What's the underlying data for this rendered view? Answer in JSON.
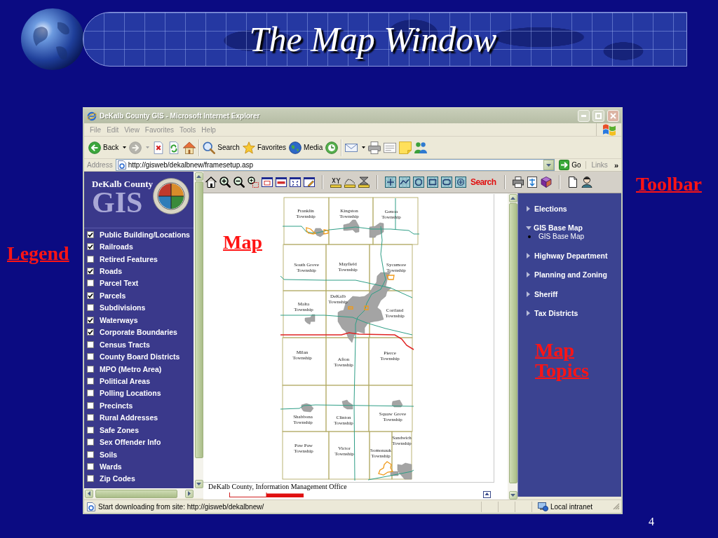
{
  "slide": {
    "title": "The Map Window",
    "page_number": "4"
  },
  "callouts": {
    "toolbar": "Toolbar",
    "map": "Map",
    "legend": "Legend",
    "map_topics": "Map Topics"
  },
  "window": {
    "title": "DeKalb County GIS - Microsoft Internet Explorer",
    "active": false
  },
  "menu": [
    "File",
    "Edit",
    "View",
    "Favorites",
    "Tools",
    "Help"
  ],
  "toolbar": [
    {
      "kind": "back",
      "label": "Back",
      "menu": true,
      "disabled": false
    },
    {
      "kind": "forward",
      "menu": true,
      "disabled": true
    },
    {
      "kind": "stop",
      "menu": false,
      "disabled": false
    },
    {
      "kind": "refresh",
      "menu": false,
      "disabled": false
    },
    {
      "kind": "home",
      "menu": false,
      "disabled": false
    },
    {
      "kind": "separator"
    },
    {
      "kind": "search",
      "label": "Search",
      "menu": false,
      "disabled": false
    },
    {
      "kind": "favorites",
      "label": "Favorites",
      "menu": false,
      "disabled": false
    },
    {
      "kind": "media",
      "label": "Media",
      "menu": false,
      "disabled": false
    },
    {
      "kind": "history",
      "menu": false,
      "disabled": false
    },
    {
      "kind": "separator"
    },
    {
      "kind": "mail",
      "menu": true,
      "disabled": false
    },
    {
      "kind": "print",
      "menu": false,
      "disabled": false
    },
    {
      "kind": "edit",
      "menu": false,
      "disabled": false
    },
    {
      "kind": "discuss",
      "menu": false,
      "disabled": false
    },
    {
      "kind": "messenger",
      "menu": false,
      "disabled": false
    }
  ],
  "address_bar": {
    "label": "Address",
    "value": "http://gisweb/dekalbnew/framesetup.asp",
    "go": "Go",
    "links": "Links",
    "links_more": "»"
  },
  "legend": {
    "county": "DeKalb County",
    "logo": "GIS",
    "layers": [
      {
        "label": "Public Building/Locations",
        "checked": true
      },
      {
        "label": "Railroads",
        "checked": true
      },
      {
        "label": "Retired Features",
        "checked": false
      },
      {
        "label": "Roads",
        "checked": true
      },
      {
        "label": "Parcel Text",
        "checked": false
      },
      {
        "label": "Parcels",
        "checked": true
      },
      {
        "label": "Subdivisions",
        "checked": false
      },
      {
        "label": "Waterways",
        "checked": true
      },
      {
        "label": "Corporate Boundaries",
        "checked": true
      },
      {
        "label": "Census Tracts",
        "checked": false
      },
      {
        "label": "County Board Districts",
        "checked": false
      },
      {
        "label": "MPO (Metro Area)",
        "checked": false
      },
      {
        "label": "Political Areas",
        "checked": false
      },
      {
        "label": "Polling Locations",
        "checked": false
      },
      {
        "label": "Precincts",
        "checked": false
      },
      {
        "label": "Rural Addresses",
        "checked": false
      },
      {
        "label": "Safe Zones",
        "checked": false
      },
      {
        "label": "Sex Offender Info",
        "checked": false
      },
      {
        "label": "Soils",
        "checked": false
      },
      {
        "label": "Wards",
        "checked": false
      },
      {
        "label": "Zip Codes",
        "checked": false
      }
    ]
  },
  "map_toolbar": [
    {
      "kind": "home"
    },
    {
      "kind": "zoom-in"
    },
    {
      "kind": "zoom-out"
    },
    {
      "kind": "zoom-box"
    },
    {
      "kind": "window"
    },
    {
      "kind": "window-bar"
    },
    {
      "kind": "window-arrows"
    },
    {
      "kind": "window-pen"
    },
    {
      "kind": "separator"
    },
    {
      "kind": "xy"
    },
    {
      "kind": "measure"
    },
    {
      "kind": "hourglass"
    },
    {
      "kind": "separator"
    },
    {
      "kind": "grid-cross"
    },
    {
      "kind": "grid-line"
    },
    {
      "kind": "grid-circle"
    },
    {
      "kind": "grid-square"
    },
    {
      "kind": "grid-rounded"
    },
    {
      "kind": "grid-plus"
    },
    {
      "kind": "search",
      "label": "Search"
    },
    {
      "kind": "separator"
    },
    {
      "kind": "print"
    },
    {
      "kind": "export"
    },
    {
      "kind": "book"
    },
    {
      "kind": "separator"
    },
    {
      "kind": "page"
    },
    {
      "kind": "person"
    }
  ],
  "map": {
    "townships": [
      {
        "lines": [
          "Franklin",
          "Township"
        ]
      },
      {
        "lines": [
          "Kingston",
          "Township"
        ]
      },
      {
        "lines": [
          "Genoa",
          "Township"
        ]
      },
      {
        "lines": [
          "South Grove",
          "Township"
        ]
      },
      {
        "lines": [
          "Mayfield",
          "Township"
        ]
      },
      {
        "lines": [
          "Sycamore",
          "Township"
        ]
      },
      {
        "lines": [
          "Malta",
          "Township"
        ]
      },
      {
        "lines": [
          "DeKalb",
          "Township"
        ]
      },
      {
        "lines": [
          "Cortland",
          "Township"
        ]
      },
      {
        "lines": [
          "Milan",
          "Township"
        ]
      },
      {
        "lines": [
          "Afton",
          "Township"
        ]
      },
      {
        "lines": [
          "Pierce",
          "Township"
        ]
      },
      {
        "lines": [
          "Shabbona",
          "Township"
        ]
      },
      {
        "lines": [
          "Clinton",
          "Township"
        ]
      },
      {
        "lines": [
          "Squaw Grove",
          "Township"
        ]
      },
      {
        "lines": [
          "Paw Paw",
          "Township"
        ]
      },
      {
        "lines": [
          "Victor",
          "Township"
        ]
      },
      {
        "lines": [
          "Somonauk",
          "Township"
        ]
      },
      {
        "lines": [
          "Sandwich",
          "Township"
        ]
      }
    ],
    "caption": "DeKalb County, Information Management Office"
  },
  "topics": [
    {
      "label": "Elections",
      "expanded": false
    },
    {
      "label": "GIS Base Map",
      "expanded": true,
      "children": [
        {
          "label": "GIS Base Map"
        }
      ]
    },
    {
      "label": "Highway Department",
      "expanded": false
    },
    {
      "label": "Planning and Zoning",
      "expanded": false
    },
    {
      "label": "Sheriff",
      "expanded": false
    },
    {
      "label": "Tax Districts",
      "expanded": false
    }
  ],
  "status_bar": {
    "text": "Start downloading from site: http://gisweb/dekalbnew/",
    "zone": "Local intranet"
  }
}
